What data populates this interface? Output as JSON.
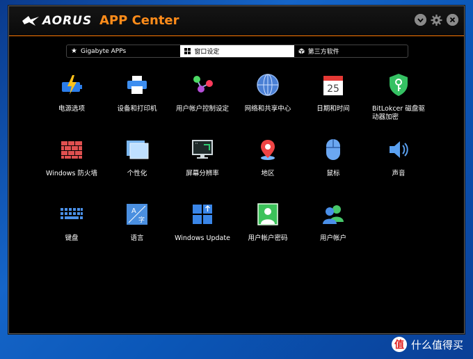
{
  "window": {
    "brand": "AORUS",
    "app_title": "APP Center"
  },
  "tabs": [
    {
      "label": "Gigabyte APPs",
      "icon": "star-icon"
    },
    {
      "label": "窗口设定",
      "icon": "windows-grid-icon"
    },
    {
      "label": "第三方软件",
      "icon": "cube-icon"
    }
  ],
  "items": [
    {
      "label": "电源选项",
      "icon": "battery-icon"
    },
    {
      "label": "设备和打印机",
      "icon": "printer-icon"
    },
    {
      "label": "用户帐户控制设定",
      "icon": "user-account-control-icon"
    },
    {
      "label": "网络和共享中心",
      "icon": "network-globe-icon"
    },
    {
      "label": "日期和时间",
      "icon": "calendar-icon",
      "date": "25"
    },
    {
      "label": "BitLokcer 磁盘驱动器加密",
      "icon": "shield-key-icon"
    },
    {
      "label": "Windows 防火墙",
      "icon": "firewall-icon"
    },
    {
      "label": "个性化",
      "icon": "personalization-icon"
    },
    {
      "label": "屏幕分辨率",
      "icon": "monitor-icon"
    },
    {
      "label": "地区",
      "icon": "location-pin-icon"
    },
    {
      "label": "鼠标",
      "icon": "mouse-icon"
    },
    {
      "label": "声音",
      "icon": "speaker-icon"
    },
    {
      "label": "键盘",
      "icon": "keyboard-icon"
    },
    {
      "label": "语言",
      "icon": "language-icon"
    },
    {
      "label": "Windows Update",
      "icon": "windows-update-icon"
    },
    {
      "label": "用户帐户密码",
      "icon": "user-password-icon"
    },
    {
      "label": "用户帐户",
      "icon": "user-accounts-icon"
    }
  ],
  "watermark": {
    "badge": "值",
    "text": "什么值得买"
  },
  "colors": {
    "accent": "#ff8c1a",
    "window_bg": "#000000"
  }
}
